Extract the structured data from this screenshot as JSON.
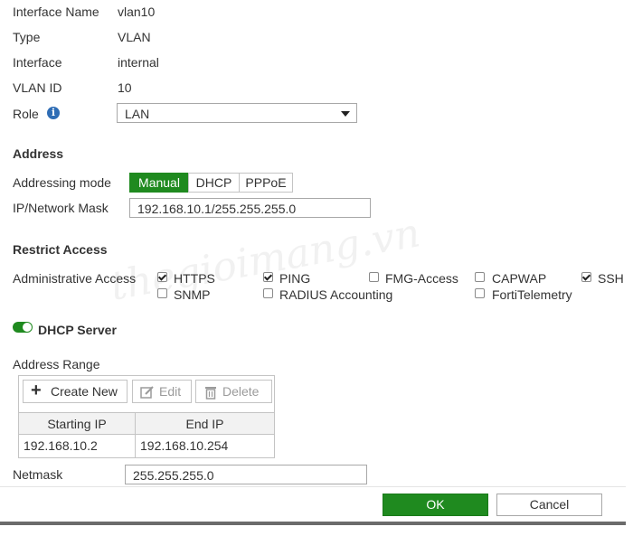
{
  "fields": {
    "interface_name": {
      "label": "Interface Name",
      "value": "vlan10"
    },
    "type": {
      "label": "Type",
      "value": "VLAN"
    },
    "interface": {
      "label": "Interface",
      "value": "internal"
    },
    "vlan_id": {
      "label": "VLAN ID",
      "value": "10"
    },
    "role": {
      "label": "Role",
      "value": "LAN",
      "info_icon": "info-icon"
    }
  },
  "address": {
    "heading": "Address",
    "mode_label": "Addressing mode",
    "modes": [
      "Manual",
      "DHCP",
      "PPPoE"
    ],
    "active_mode": "Manual",
    "ip_label": "IP/Network Mask",
    "ip_value": "192.168.10.1/255.255.255.0"
  },
  "restrict_access": {
    "heading": "Restrict Access",
    "admin_label": "Administrative Access",
    "options": [
      {
        "label": "HTTPS",
        "checked": true
      },
      {
        "label": "PING",
        "checked": true
      },
      {
        "label": "FMG-Access",
        "checked": false
      },
      {
        "label": "CAPWAP",
        "checked": false
      },
      {
        "label": "SSH",
        "checked": true
      },
      {
        "label": "SNMP",
        "checked": false
      },
      {
        "label": "RADIUS Accounting",
        "checked": false
      },
      {
        "label": "FortiTelemetry",
        "checked": false
      }
    ]
  },
  "dhcp": {
    "toggle_label": "DHCP Server",
    "enabled": true,
    "range_label": "Address Range",
    "toolbar": {
      "create": "Create New",
      "edit": "Edit",
      "delete": "Delete"
    },
    "columns": [
      "Starting IP",
      "End IP"
    ],
    "rows": [
      [
        "192.168.10.2",
        "192.168.10.254"
      ]
    ],
    "netmask_label": "Netmask",
    "netmask_value": "255.255.255.0"
  },
  "footer": {
    "ok": "OK",
    "cancel": "Cancel"
  },
  "watermark": "thegioimang.vn",
  "colors": {
    "accent": "#1f8a1f",
    "info": "#2f6db5"
  }
}
